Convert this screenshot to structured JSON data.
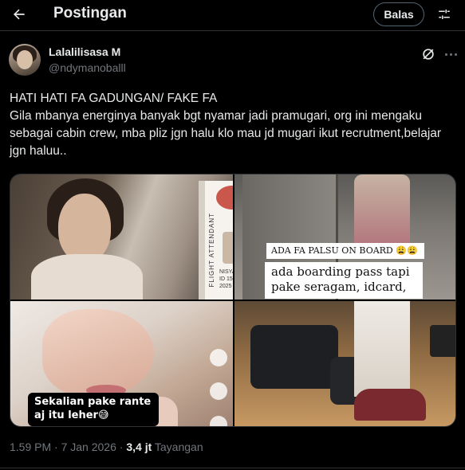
{
  "header": {
    "title": "Postingan",
    "reply_button": "Balas"
  },
  "author": {
    "name": "Lalalilisasa M",
    "handle": "@ndymanoballl"
  },
  "post": {
    "line1": "HATI HATI FA GADUNGAN/ FAKE FA",
    "line2": "Gila mbanya energinya banyak bgt nyamar jadi pramugari, org ini mengaku sebagai cabin crew, mba pliz jgn halu klo mau jd mugari ikut recrutment,belajar jgn haluu.."
  },
  "media": {
    "card_side_text": "FLIGHT ATTENDANT",
    "card_name": "NISYA\nID 15\n2025",
    "caption1": "ADA FA PALSU ON BOARD 😩😩",
    "caption2": "ada boarding pass tapi pake seragam, idcard,",
    "caption3": "Sekalian pake rante aj itu leher😅"
  },
  "meta": {
    "time": "1.59 PM",
    "date": "7 Jan 2026",
    "views_count": "3,4 jt",
    "views_label": "Tayangan"
  },
  "colors": {
    "background": "#000000",
    "text": "#e7e9ea",
    "secondary": "#71767b",
    "border": "#2f3336"
  }
}
